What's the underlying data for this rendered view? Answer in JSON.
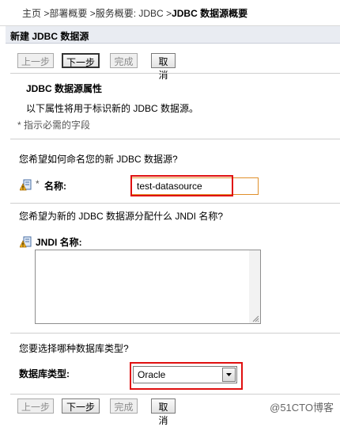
{
  "breadcrumb": {
    "items": [
      "主页",
      "部署概要",
      "服务概要: JDBC",
      "JDBC 数据源概要"
    ],
    "separator": " >"
  },
  "title": "新建 JDBC 数据源",
  "buttons": {
    "back": "上一步",
    "next": "下一步",
    "finish": "完成",
    "cancel": "取消"
  },
  "section": {
    "heading": "JDBC 数据源属性",
    "description": "以下属性将用于标识新的 JDBC 数据源。",
    "required_note": "* 指示必需的字段"
  },
  "name_block": {
    "question": "您希望如何命名您的新 JDBC 数据源?",
    "required_mark": "*",
    "label": "名称:",
    "value": "test-datasource",
    "icon": "info-field-icon"
  },
  "jndi_block": {
    "question": "您希望为新的 JDBC 数据源分配什么 JNDI 名称?",
    "label": "JNDI 名称:",
    "value": "",
    "icon": "info-field-icon"
  },
  "dbtype_block": {
    "question": "您要选择哪种数据库类型?",
    "label": "数据库类型:",
    "selected": "Oracle"
  },
  "watermark": "@51CTO博客",
  "colors": {
    "title_bar": "#e9ecf2",
    "highlight_box": "#e01010",
    "input_border": "#e0902b"
  }
}
